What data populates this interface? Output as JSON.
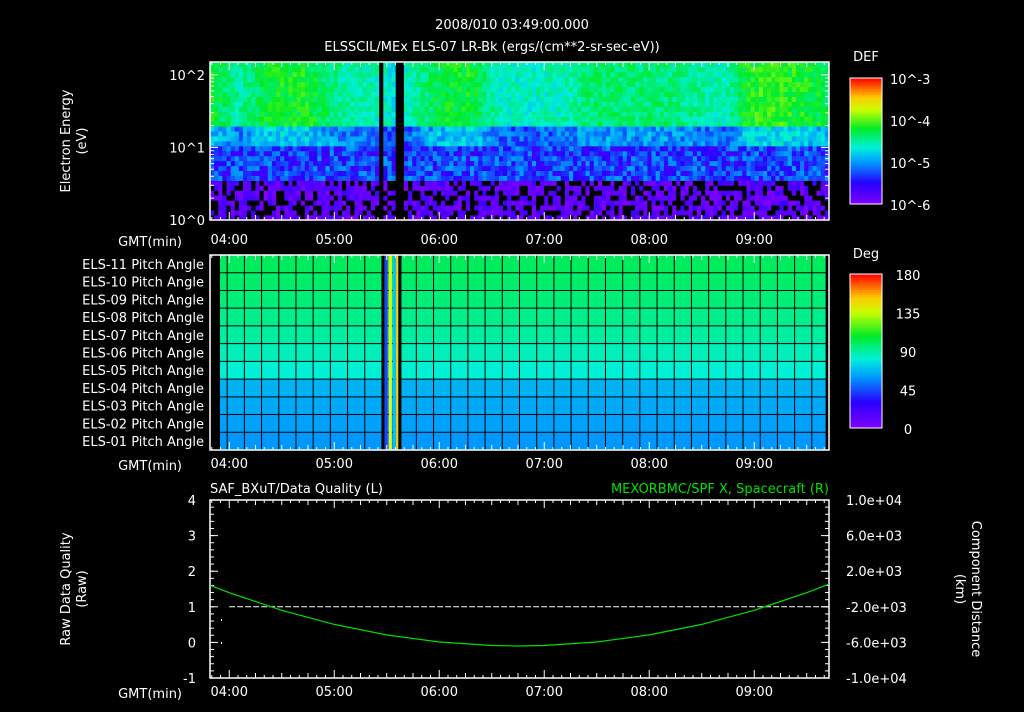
{
  "header": {
    "timestamp": "2008/010 03:49:00.000"
  },
  "colors": {
    "background": "#000000",
    "axis": "#ffffff",
    "position_line": "#00e000"
  },
  "chart_data": [
    {
      "type": "heatmap",
      "title": "ELSSCIL/MEx ELS-07 LR-Bk  (ergs/(cm**2-sr-sec-eV))",
      "ylabel_lines": [
        "Electron Energy",
        "(eV)"
      ],
      "yscale": "log",
      "ylim": [
        1,
        150
      ],
      "ytick_labels": [
        "10^0",
        "10^1",
        "10^2"
      ],
      "xlabel": "GMT(min)",
      "xlim_hours": [
        3.8167,
        9.712
      ],
      "xtick_labels": [
        "04:00",
        "05:00",
        "06:00",
        "07:00",
        "08:00",
        "09:00"
      ],
      "colorbar": {
        "label": "DEF",
        "scale": "log",
        "range_log10": [
          -6,
          -3
        ],
        "tick_labels": [
          "10^-3",
          "10^-4",
          "10^-5",
          "10^-6"
        ]
      },
      "high_energy_activity": {
        "hours": [
          3.82,
          4.1,
          4.4,
          4.75,
          5.1,
          5.45,
          5.6,
          6.0,
          6.3,
          6.6,
          6.9,
          7.2,
          7.5,
          7.8,
          8.1,
          8.4,
          8.7,
          8.95,
          9.2,
          9.5,
          9.71
        ],
        "log10_def": [
          -4.2,
          -4.5,
          -4.2,
          -4.2,
          -4.5,
          -4.6,
          -4.7,
          -4.25,
          -4.2,
          -4.6,
          -4.6,
          -4.55,
          -4.35,
          -4.4,
          -4.4,
          -4.45,
          -4.6,
          -4.15,
          -4.1,
          -4.2,
          -4.3
        ]
      },
      "data_gaps_hours": [
        [
          5.45,
          5.465
        ],
        [
          5.61,
          5.64
        ]
      ]
    },
    {
      "type": "heatmap",
      "colorbar": {
        "label": "Deg",
        "range": [
          0,
          180
        ],
        "tick_labels": [
          "180",
          "135",
          "90",
          "45",
          "0"
        ]
      },
      "rows": [
        {
          "label": "ELS-11 Pitch Angle",
          "value": 100
        },
        {
          "label": "ELS-10 Pitch Angle",
          "value": 98
        },
        {
          "label": "ELS-09 Pitch Angle",
          "value": 96
        },
        {
          "label": "ELS-08 Pitch Angle",
          "value": 93
        },
        {
          "label": "ELS-07 Pitch Angle",
          "value": 90
        },
        {
          "label": "ELS-06 Pitch Angle",
          "value": 86
        },
        {
          "label": "ELS-05 Pitch Angle",
          "value": 82
        },
        {
          "label": "ELS-04 Pitch Angle",
          "value": 66
        },
        {
          "label": "ELS-03 Pitch Angle",
          "value": 64
        },
        {
          "label": "ELS-02 Pitch Angle",
          "value": 62
        },
        {
          "label": "ELS-01 Pitch Angle",
          "value": 60
        }
      ],
      "xlabel": "GMT(min)",
      "xtick_labels": [
        "04:00",
        "05:00",
        "06:00",
        "07:00",
        "08:00",
        "09:00"
      ],
      "data_gaps_hours": [
        [
          5.45,
          5.465
        ],
        [
          5.61,
          5.64
        ],
        [
          9.68,
          9.712
        ]
      ]
    },
    {
      "type": "line",
      "title_left": "SAF_BXuT/Data Quality (L)",
      "title_right": "MEXORBMC/SPF X, Spacecraft (R)",
      "ylabel_left_lines": [
        "Raw Data Quality",
        "(Raw)"
      ],
      "ylabel_right_lines": [
        "Component Distance",
        "(km)"
      ],
      "ylim_left": [
        -1,
        4
      ],
      "ytick_labels_left": [
        "4",
        "3",
        "2",
        "1",
        "0",
        "-1"
      ],
      "ylim_right": [
        -10000,
        10000
      ],
      "ytick_labels_right": [
        "1.0e+04",
        "6.0e+03",
        "2.0e+03",
        "-2.0e+03",
        "-6.0e+03",
        "-1.0e+04"
      ],
      "xlabel": "GMT(min)",
      "xtick_labels": [
        "04:00",
        "05:00",
        "06:00",
        "07:00",
        "08:00",
        "09:00"
      ],
      "series": [
        {
          "name": "Data Quality",
          "axis": "left",
          "style": "dashed",
          "x_hours": [
            4.0,
            9.7
          ],
          "y": [
            1,
            1
          ]
        },
        {
          "name": "X, Spacecraft",
          "axis": "right",
          "style": "solid",
          "x_hours": [
            3.82,
            4.0,
            4.5,
            5.0,
            5.5,
            6.0,
            6.5,
            6.75,
            7.0,
            7.5,
            8.0,
            8.5,
            9.0,
            9.5,
            9.71
          ],
          "y": [
            400,
            -412,
            -2391,
            -3974,
            -5162,
            -5954,
            -6350,
            -6400,
            -6350,
            -5954,
            -5162,
            -3974,
            -2391,
            -412,
            540
          ]
        }
      ]
    }
  ]
}
